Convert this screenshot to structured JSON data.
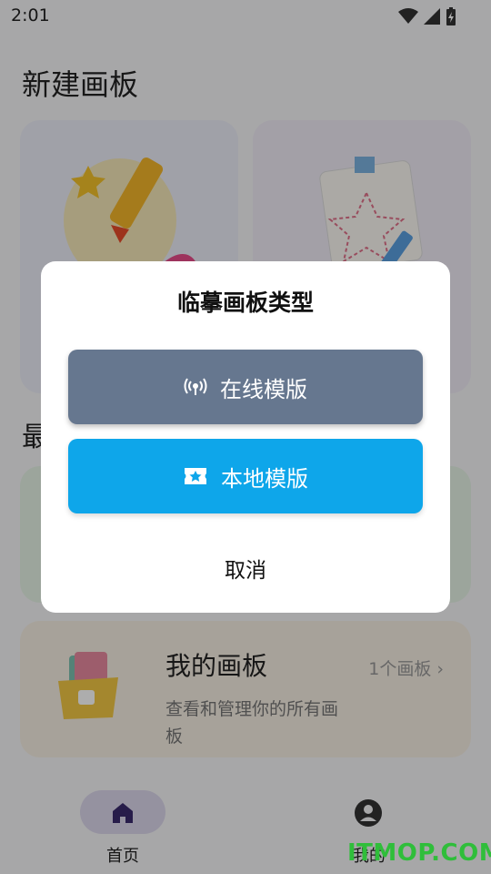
{
  "status_bar": {
    "time": "2:01"
  },
  "page": {
    "title": "新建画板",
    "recent_section": "最"
  },
  "my_boards": {
    "title": "我的画板",
    "description": "查看和管理你的所有画板",
    "count": "1个画板",
    "chevron": "›"
  },
  "bottom_nav": {
    "home_label": "首页",
    "me_label": "我的"
  },
  "dialog": {
    "title": "临摹画板类型",
    "online_label": "在线模版",
    "local_label": "本地模版",
    "cancel_label": "取消"
  },
  "watermark": "ITMOP.COM",
  "colors": {
    "online_button": "#66778f",
    "local_button": "#0ea6ea",
    "home_pill": "#dcd8ec",
    "accent": "#3a2a6e"
  }
}
